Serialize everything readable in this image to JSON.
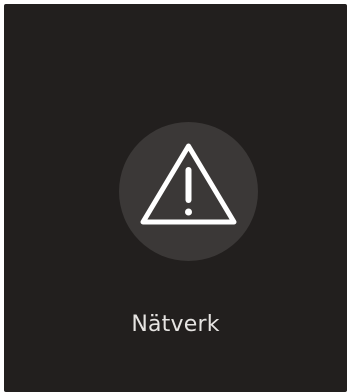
{
  "tile": {
    "label": "Nätverk",
    "icon": "warning-triangle-icon",
    "colors": {
      "background": "#221f1e",
      "icon_circle": "#3b3837",
      "icon_stroke": "#ffffff",
      "label_text": "#e6e4e2"
    }
  }
}
